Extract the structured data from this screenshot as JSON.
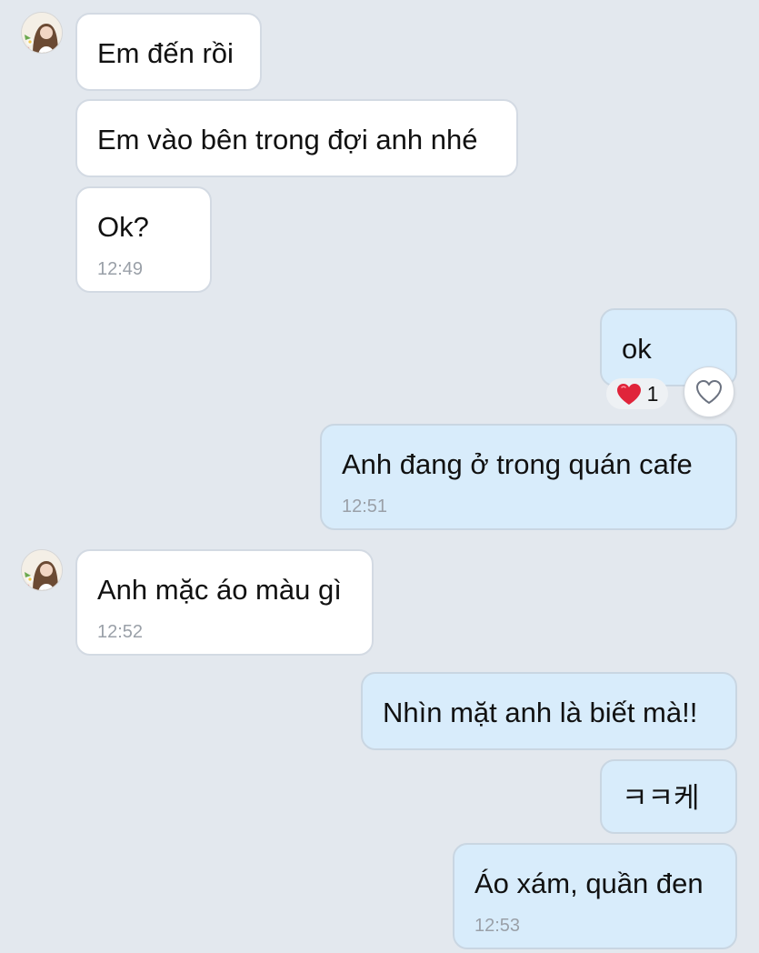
{
  "messages": [
    {
      "id": "m1",
      "direction": "incoming",
      "text": "Em đến rồi",
      "time": ""
    },
    {
      "id": "m2",
      "direction": "incoming",
      "text": "Em vào bên trong đợi anh nhé",
      "time": ""
    },
    {
      "id": "m3",
      "direction": "incoming",
      "text": "Ok?",
      "time": "12:49"
    },
    {
      "id": "m4",
      "direction": "outgoing",
      "text": "ok",
      "time": "",
      "reaction": {
        "emoji": "heart",
        "count": "1"
      }
    },
    {
      "id": "m5",
      "direction": "outgoing",
      "text": "Anh đang ở trong quán cafe",
      "time": "12:51"
    },
    {
      "id": "m6",
      "direction": "incoming",
      "text": "Anh mặc áo màu gì",
      "time": "12:52"
    },
    {
      "id": "m7",
      "direction": "outgoing",
      "text": "Nhìn mặt anh là biết mà!!",
      "time": ""
    },
    {
      "id": "m8",
      "direction": "outgoing",
      "text": "ㅋㅋ케",
      "time": ""
    },
    {
      "id": "m9",
      "direction": "outgoing",
      "text": "Áo xám, quần đen",
      "time": "12:53"
    }
  ],
  "icons": {
    "avatar": "contact-avatar",
    "reaction": "heart-icon",
    "react_button": "heart-outline-icon"
  },
  "colors": {
    "background": "#e3e8ee",
    "incoming_bubble": "#ffffff",
    "outgoing_bubble": "#d8ecfb",
    "timestamp": "#9aa0a8",
    "heart": "#e0243a"
  }
}
